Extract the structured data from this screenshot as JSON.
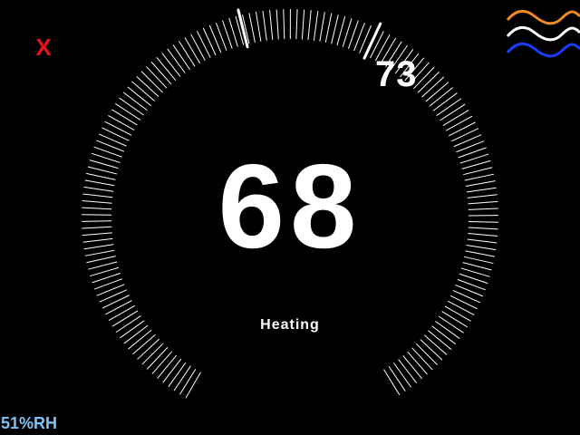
{
  "thermostat": {
    "close_label": "X",
    "current_temp": "68",
    "setpoint": "73",
    "mode": "Heating",
    "humidity": "51%RH"
  },
  "colors": {
    "background": "#000000",
    "ticks": "#ffffff",
    "close": "#e8121b",
    "humidity": "#7ec3f2",
    "wave_top": "#f08a24",
    "wave_middle": "#ffffff",
    "wave_bottom": "#1a3cff"
  },
  "icons": {
    "close": "close-icon",
    "menu": "wave-menu-icon"
  }
}
